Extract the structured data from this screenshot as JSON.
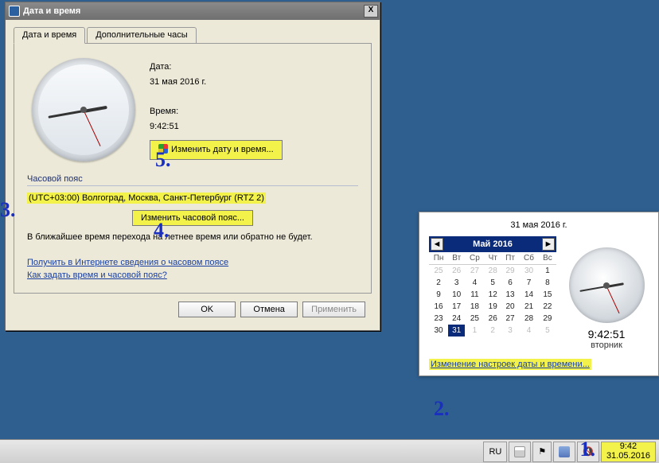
{
  "dialog": {
    "title": "Дата и время",
    "tabs": {
      "tab1": "Дата и время",
      "tab2": "Дополнительные часы"
    },
    "date_label": "Дата:",
    "date_value": "31 мая 2016 г.",
    "time_label": "Время:",
    "time_value": "9:42:51",
    "change_dt_btn": "Изменить дату и время...",
    "tz_header": "Часовой пояс",
    "tz_value": "(UTC+03:00) Волгоград, Москва, Санкт-Петербург (RTZ 2)",
    "change_tz_btn": "Изменить часовой пояс...",
    "dst_note": "В ближайшее время перехода на летнее время или обратно не будет.",
    "link1": "Получить в Интернете сведения о часовом поясе",
    "link2": "Как задать время и часовой пояс?",
    "ok": "OK",
    "cancel": "Отмена",
    "apply": "Применить",
    "close_x": "X"
  },
  "popup": {
    "date_head": "31 мая 2016 г.",
    "month_label": "Май 2016",
    "dows": [
      "Пн",
      "Вт",
      "Ср",
      "Чт",
      "Пт",
      "Сб",
      "Вс"
    ],
    "prev_tail": [
      25,
      26,
      27,
      28,
      29,
      30,
      1
    ],
    "weeks": [
      [
        2,
        3,
        4,
        5,
        6,
        7,
        8
      ],
      [
        9,
        10,
        11,
        12,
        13,
        14,
        15
      ],
      [
        16,
        17,
        18,
        19,
        20,
        21,
        22
      ],
      [
        23,
        24,
        25,
        26,
        27,
        28,
        29
      ]
    ],
    "last_row": [
      30,
      31,
      1,
      2,
      3,
      4,
      5
    ],
    "selected_day": 31,
    "time": "9:42:51",
    "dow": "вторник",
    "settings_link": "Изменение настроек даты и времени..."
  },
  "taskbar": {
    "lang": "RU",
    "time": "9:42",
    "date": "31.05.2016"
  },
  "annotations": {
    "n1": "1.",
    "n2": "2.",
    "n3": "3.",
    "n4": "4.",
    "n5": "5."
  }
}
